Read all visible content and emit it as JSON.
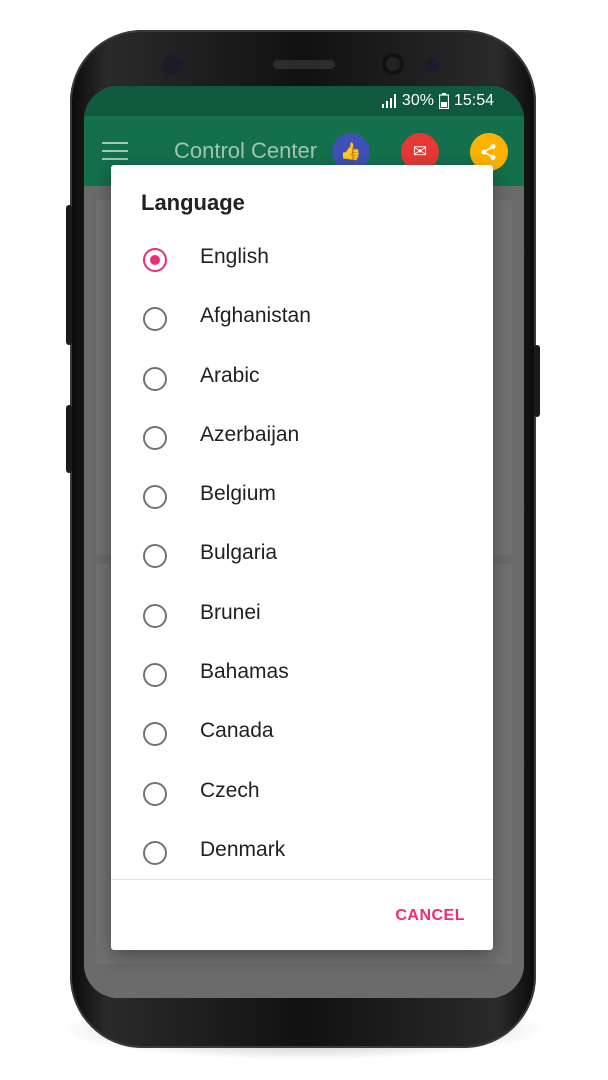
{
  "status_bar": {
    "battery": "30%",
    "time": "15:54",
    "icons": [
      "signal-icon",
      "battery-icon"
    ]
  },
  "app_bar": {
    "title": "Control Center",
    "icons": [
      "menu-icon",
      "thumbs-up-icon",
      "mail-icon",
      "share-icon"
    ],
    "icon_colors": {
      "thumbs_up": "#3f51b5",
      "mail": "#e53935",
      "share": "#ffb300"
    },
    "color": "#14704c"
  },
  "dialog": {
    "title": "Language",
    "options": [
      {
        "label": "English",
        "selected": true
      },
      {
        "label": "Afghanistan",
        "selected": false
      },
      {
        "label": "Arabic",
        "selected": false
      },
      {
        "label": "Azerbaijan",
        "selected": false
      },
      {
        "label": "Belgium",
        "selected": false
      },
      {
        "label": "Bulgaria",
        "selected": false
      },
      {
        "label": "Brunei",
        "selected": false
      },
      {
        "label": "Bahamas",
        "selected": false
      },
      {
        "label": "Canada",
        "selected": false
      },
      {
        "label": "Czech",
        "selected": false
      },
      {
        "label": "Denmark",
        "selected": false
      }
    ],
    "cancel_label": "CANCEL",
    "accent_color": "#ee2c6f"
  }
}
